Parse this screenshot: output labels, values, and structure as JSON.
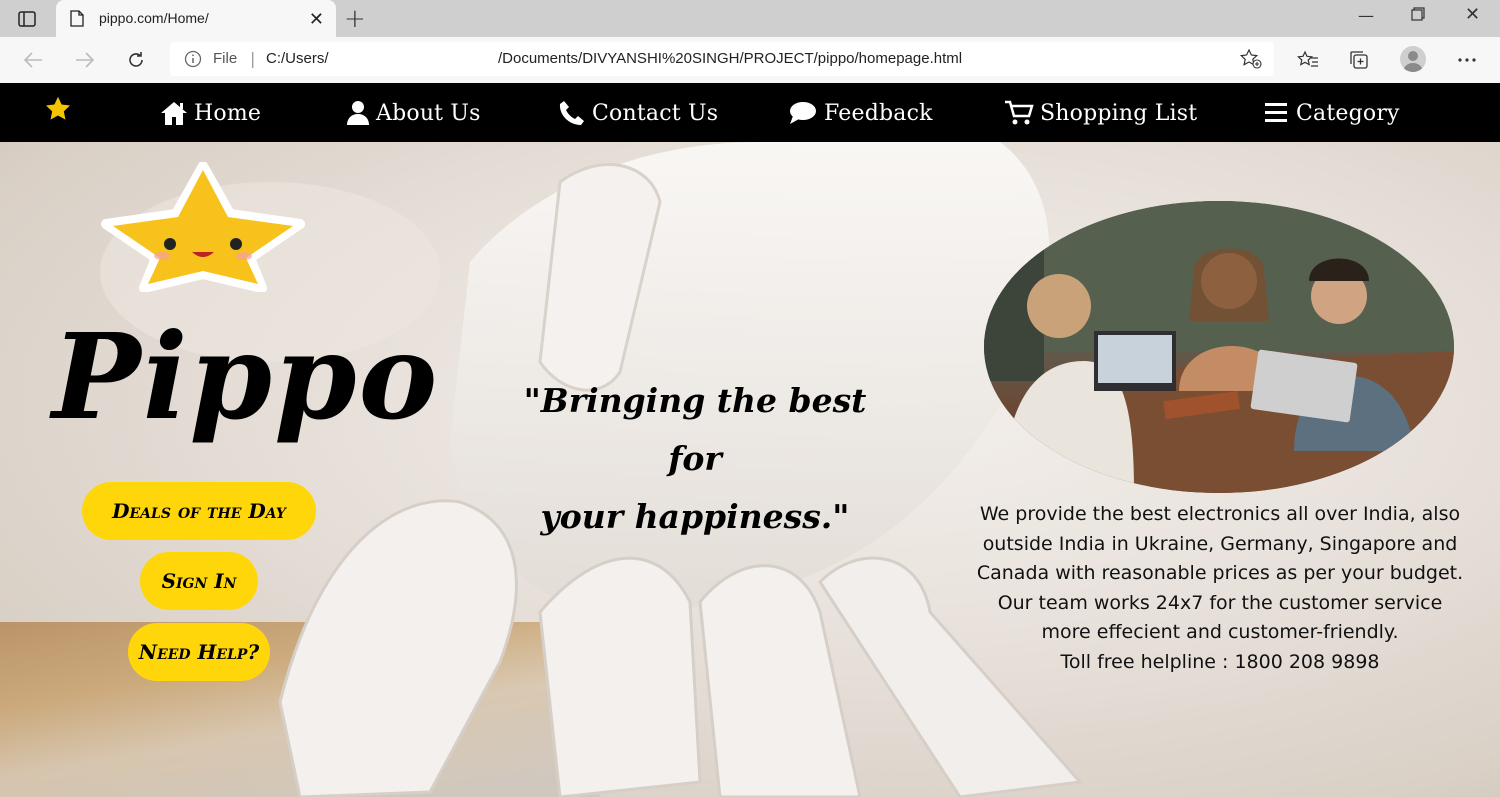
{
  "browser": {
    "tab_title": "pippo.com/Home/",
    "address": {
      "scheme_label": "File",
      "path_part1": "C:/Users/",
      "path_part2": "/Documents/DIVYANSHI%20SINGH/PROJECT/pippo/homepage.html"
    },
    "icons": [
      "tab-actions-icon",
      "page-icon",
      "close-icon",
      "new-tab-icon",
      "minimize-icon",
      "restore-icon",
      "window-close-icon",
      "back-icon",
      "forward-icon",
      "refresh-icon",
      "info-icon",
      "add-favorite-icon",
      "favorites-icon",
      "collections-icon",
      "profile-icon",
      "more-icon"
    ]
  },
  "site_nav": {
    "items": [
      {
        "label": "Home",
        "icon": "home-icon"
      },
      {
        "label": "About Us",
        "icon": "user-icon"
      },
      {
        "label": "Contact Us",
        "icon": "phone-icon"
      },
      {
        "label": "Feedback",
        "icon": "comment-icon"
      },
      {
        "label": "Shopping List",
        "icon": "cart-icon"
      },
      {
        "label": "Category",
        "icon": "menu-icon"
      }
    ],
    "accent_star_color": "#f5c400"
  },
  "hero": {
    "brand": "Pippo",
    "buttons": {
      "deals": "Deals of the Day",
      "sign_in": "Sign In",
      "help": "Need Help?"
    },
    "tagline_line1": "\"Bringing the best for",
    "tagline_line2": "your happiness.\"",
    "about_lines": [
      "We provide the best electronics all over India, also",
      "outside India in Ukraine, Germany, Singapore and",
      "Canada with reasonable prices as per your budget.",
      "Our team works 24x7 for the customer service",
      "more effecient and customer-friendly.",
      "Toll free helpline : 1800 208 9898"
    ],
    "button_color": "#ffd60a"
  }
}
